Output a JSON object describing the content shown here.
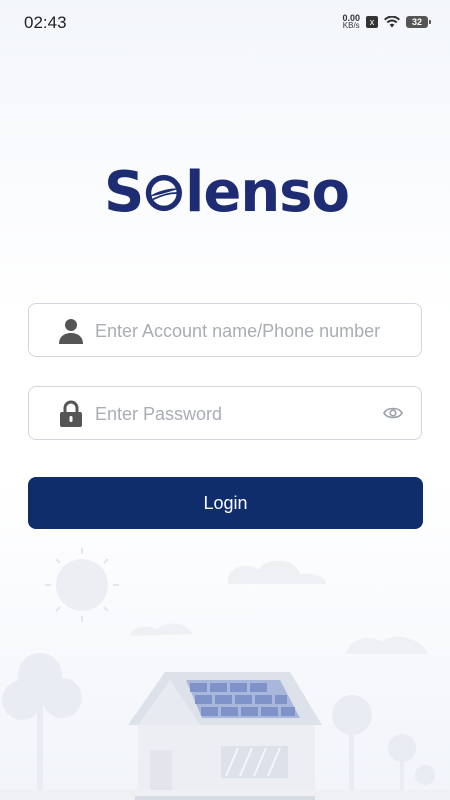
{
  "status_bar": {
    "time": "02:43",
    "net_speed_value": "0.00",
    "net_speed_unit": "KB/s",
    "x_badge": "x",
    "battery": "32",
    "wifi_icon": "wifi-icon"
  },
  "app": {
    "logo_left": "S",
    "logo_right": "lenso",
    "brand_color": "#1d2c73"
  },
  "login_form": {
    "account_placeholder": "Enter Account name/Phone number",
    "account_value": "",
    "password_placeholder": "Enter Password",
    "password_value": "",
    "login_label": "Login",
    "button_color": "#0f2c6b"
  }
}
